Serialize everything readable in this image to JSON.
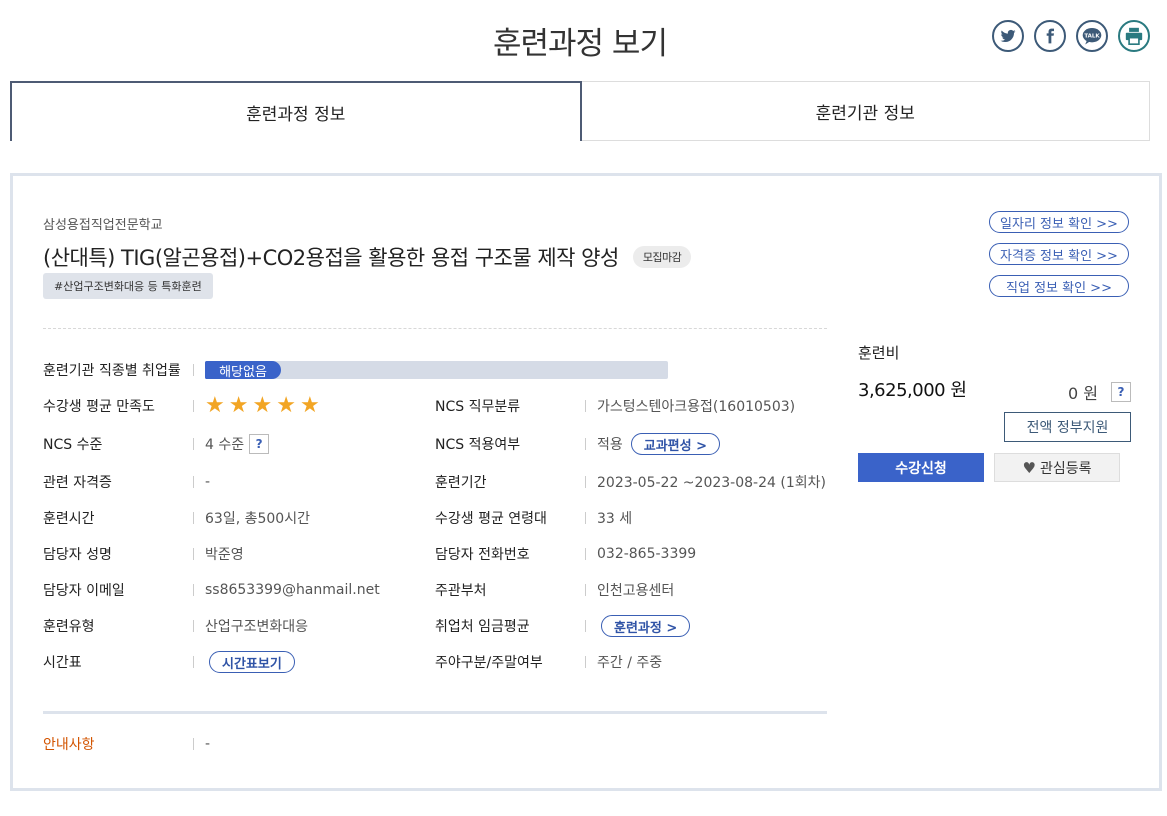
{
  "page": {
    "title": "훈련과정 보기"
  },
  "share": {
    "twitter": "twitter-icon",
    "facebook": "facebook-icon",
    "kakao": "TALK",
    "print": "print-icon"
  },
  "tabs": [
    {
      "label": "훈련과정 정보",
      "active": true
    },
    {
      "label": "훈련기관 정보",
      "active": false
    }
  ],
  "course": {
    "institution": "삼성용접직업전문학교",
    "title": "(산대특) TIG(알곤용접)+CO2용접을 활용한 용접 구조물 제작 양성",
    "status_badge": "모집마감",
    "tag": "#산업구조변화대응 등 특화훈련"
  },
  "links": [
    "일자리 정보 확인 >>",
    "자격증 정보 확인 >>",
    "직업 정보 확인 >>"
  ],
  "info": {
    "employment_rate": {
      "label": "훈련기관 직종별 취업률",
      "value": "해당없음"
    },
    "satisfaction": {
      "label": "수강생 평균 만족도",
      "stars": 5
    },
    "ncs_class": {
      "label": "NCS 직무분류",
      "value": "가스텅스텐아크용접(16010503)"
    },
    "ncs_level": {
      "label": "NCS 수준",
      "value": "4 수준",
      "help": "?"
    },
    "ncs_applied": {
      "label": "NCS 적용여부",
      "value": "적용",
      "button": "교과편성 >"
    },
    "cert": {
      "label": "관련 자격증",
      "value": "-"
    },
    "period": {
      "label": "훈련기간",
      "value": "2023-05-22 ~2023-08-24 (1회차)"
    },
    "hours": {
      "label": "훈련시간",
      "value": "63일, 총500시간"
    },
    "age": {
      "label": "수강생 평균 연령대",
      "value": "33 세"
    },
    "manager": {
      "label": "담당자 성명",
      "value": "박준영"
    },
    "phone": {
      "label": "담당자 전화번호",
      "value": "032-865-3399"
    },
    "email": {
      "label": "담당자 이메일",
      "value": "ss8653399@hanmail.net"
    },
    "dept": {
      "label": "주관부처",
      "value": "인천고용센터"
    },
    "type": {
      "label": "훈련유형",
      "value": "산업구조변화대응"
    },
    "wage": {
      "label": "취업처 임금평균",
      "button": "훈련과정 >"
    },
    "timetable": {
      "label": "시간표",
      "button": "시간표보기"
    },
    "daynight": {
      "label": "주야구분/주말여부",
      "value": "주간 / 주중"
    },
    "notice": {
      "label": "안내사항",
      "value": "-"
    }
  },
  "fee": {
    "label": "훈련비",
    "amount": "3,625,000 원",
    "self_pay": "0 원",
    "help": "?",
    "support": "전액 정부지원",
    "apply": "수강신청",
    "favorite": "관심등록"
  },
  "colors": {
    "accent": "#3a63c9",
    "border": "#dde3ec",
    "notice": "#d35400",
    "star": "#f2a524"
  }
}
